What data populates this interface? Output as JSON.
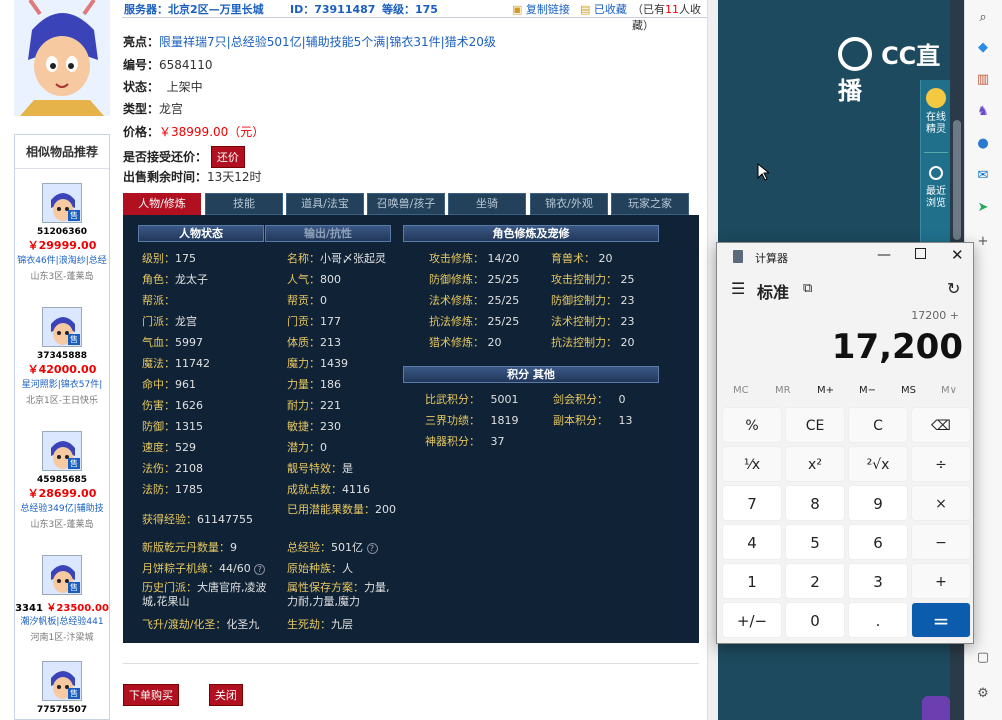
{
  "topbar": {
    "server_label": "服务器：北京2区—万里长城",
    "id_label": "ID：73911487",
    "level_label": "等级：175",
    "copy_link": "复制链接",
    "collected": "已收藏",
    "collect_count_prefix": "（已有",
    "collect_count": "11",
    "collect_count_suffix": "人收藏）"
  },
  "item": {
    "highlight_key": "亮点：",
    "highlight_val": "限量祥瑞7只|总经验501亿|辅助技能5个满|锦衣31件|猎术20级",
    "id_key": "编号：",
    "id_val": "6584110",
    "status_key": "状态：",
    "status_val": "上架中",
    "type_key": "类型：",
    "type_val": "龙宫",
    "price_key": "价格：",
    "price_val": "￥38999.00（元）",
    "bargain_key": "是否接受还价：",
    "bargain_btn": "还价",
    "time_key": "出售剩余时间：",
    "time_val": "13天12时"
  },
  "tabs": [
    "人物/修炼",
    "技能",
    "道具/法宝",
    "召唤兽/孩子",
    "坐骑",
    "锦衣/外观",
    "玩家之家"
  ],
  "panel": {
    "hdr_status": "人物状态",
    "hdr_output": "输出/抗性",
    "hdr_cultivation": "角色修炼及宠修",
    "hdr_points": "积分  其他",
    "col1": [
      {
        "k": "级别：",
        "v": "175"
      },
      {
        "k": "角色：",
        "v": "龙太子"
      },
      {
        "k": "帮派：",
        "v": ""
      },
      {
        "k": "门派：",
        "v": "龙宫"
      },
      {
        "k": "气血：",
        "v": "5997"
      },
      {
        "k": "魔法：",
        "v": "11742"
      },
      {
        "k": "命中：",
        "v": "961"
      },
      {
        "k": "伤害：",
        "v": "1626"
      },
      {
        "k": "防御：",
        "v": "1315"
      },
      {
        "k": "速度：",
        "v": "529"
      },
      {
        "k": "法伤：",
        "v": "2108"
      },
      {
        "k": "法防：",
        "v": "1785"
      }
    ],
    "col2": [
      {
        "k": "名称：",
        "v": "小哥〆张起灵"
      },
      {
        "k": "人气：",
        "v": "800"
      },
      {
        "k": "帮贡：",
        "v": "0"
      },
      {
        "k": "门贡：",
        "v": "177"
      },
      {
        "k": "体质：",
        "v": "213"
      },
      {
        "k": "魔力：",
        "v": "1439"
      },
      {
        "k": "力量：",
        "v": "186"
      },
      {
        "k": "耐力：",
        "v": "221"
      },
      {
        "k": "敏捷：",
        "v": "230"
      },
      {
        "k": "潜力：",
        "v": "0"
      },
      {
        "k": "靓号特效：",
        "v": "是"
      },
      {
        "k": "成就点数：",
        "v": "4116"
      }
    ],
    "lower_left": [
      {
        "k": "获得经验：",
        "v": "61147755"
      },
      {
        "k": "新版乾元丹数量：",
        "v": "9"
      },
      {
        "k": "月饼粽子机缘：",
        "v": "44/60"
      },
      {
        "k": "历史门派：",
        "v": "大唐官府,凌波城,花果山"
      },
      {
        "k": "飞升/渡劫/化圣：",
        "v": "化圣九"
      }
    ],
    "lower_right": [
      {
        "k": "已用潜能果数量：",
        "v": "200"
      },
      {
        "k": "总经验：",
        "v": "501亿"
      },
      {
        "k": "原始种族：",
        "v": "人"
      },
      {
        "k": "属性保存方案：",
        "v": "力量,力耐,力量,魔力"
      },
      {
        "k": "生死劫：",
        "v": "九层"
      }
    ],
    "cult_left": [
      {
        "k": "攻击修炼：",
        "v": "14/20"
      },
      {
        "k": "防御修炼：",
        "v": "25/25"
      },
      {
        "k": "法术修炼：",
        "v": "25/25"
      },
      {
        "k": "抗法修炼：",
        "v": "25/25"
      },
      {
        "k": "猎术修炼：",
        "v": "20"
      }
    ],
    "cult_right": [
      {
        "k": "育兽术：",
        "v": "20"
      },
      {
        "k": "攻击控制力：",
        "v": "25"
      },
      {
        "k": "防御控制力：",
        "v": "23"
      },
      {
        "k": "法术控制力：",
        "v": "23"
      },
      {
        "k": "抗法控制力：",
        "v": "20"
      }
    ],
    "points": [
      {
        "k": "比武积分：",
        "v": "5001"
      },
      {
        "k": "剑会积分：",
        "v": "0"
      },
      {
        "k": "三界功绩：",
        "v": "1819"
      },
      {
        "k": "副本积分：",
        "v": "13"
      },
      {
        "k": "神器积分：",
        "v": "37"
      }
    ]
  },
  "bottom": {
    "buy": "下单购买",
    "close": "关闭"
  },
  "similar": {
    "title": "相似物品推荐",
    "items": [
      {
        "id": "51206360",
        "price": "￥29999.00",
        "desc": "锦衣46件|浪淘纱|总经",
        "server": "山东3区-蓬莱岛"
      },
      {
        "id": "37345888",
        "price": "￥42000.00",
        "desc": "星河照影|锦衣57件|",
        "server": "北京1区-王日快乐"
      },
      {
        "id": "45985685",
        "price": "￥28699.00",
        "desc": "总经验349亿|辅助技",
        "server": "山东3区-蓬莱岛"
      },
      {
        "id": "3341",
        "price": "￥23500.00",
        "desc": "潮汐帆板|总经验441",
        "server": "河南1区-汴梁城"
      },
      {
        "id": "77575507",
        "price": "",
        "desc": "",
        "server": ""
      }
    ],
    "badge": "售"
  },
  "dark": {
    "logo": "CC直播",
    "online": "在线精灵",
    "recent": "最近浏览"
  },
  "calculator": {
    "title": "计算器",
    "mode": "标准",
    "expression": "17200 +",
    "display": "17,200",
    "memory": [
      "MC",
      "MR",
      "M+",
      "M−",
      "MS",
      "M∨"
    ],
    "keys": [
      [
        "%",
        "CE",
        "C",
        "⌫"
      ],
      [
        "¹⁄x",
        "x²",
        "²√x",
        "÷"
      ],
      [
        "7",
        "8",
        "9",
        "×"
      ],
      [
        "4",
        "5",
        "6",
        "−"
      ],
      [
        "1",
        "2",
        "3",
        "+"
      ],
      [
        "+/−",
        "0",
        ".",
        "="
      ]
    ]
  }
}
